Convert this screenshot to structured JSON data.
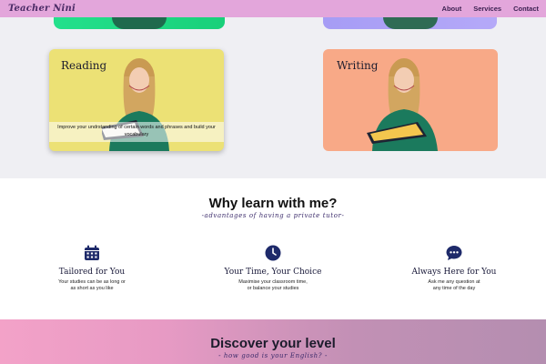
{
  "nav": {
    "brand": "Teacher Nini",
    "links": [
      "About",
      "Services",
      "Contact"
    ]
  },
  "services": {
    "cards": [
      {
        "title": "Reading",
        "description": "Improve your undrstanding of certain words and phrases and build your vocabulary"
      },
      {
        "title": "Writing",
        "description": ""
      }
    ]
  },
  "why": {
    "title": "Why learn with me?",
    "subtitle": "-advantages of having a private tutor-",
    "features": [
      {
        "icon": "calendar-icon",
        "title": "Tailored for You",
        "line1": "Your studies can be as long or",
        "line2": "as short as you like"
      },
      {
        "icon": "clock-icon",
        "title": "Your Time, Your Choice",
        "line1": "Maximise your classroom time,",
        "line2": "or balance your studies"
      },
      {
        "icon": "chat-icon",
        "title": "Always Here for You",
        "line1": "Ask me any question at",
        "line2": "any time of the day"
      }
    ]
  },
  "discover": {
    "title": "Discover your level",
    "subtitle": "- how good is your English? -"
  },
  "colors": {
    "nav_bg": "#e3a6db",
    "accent": "#1e2a6a",
    "reading_bg": "#ece175",
    "writing_bg": "#f8a987"
  }
}
